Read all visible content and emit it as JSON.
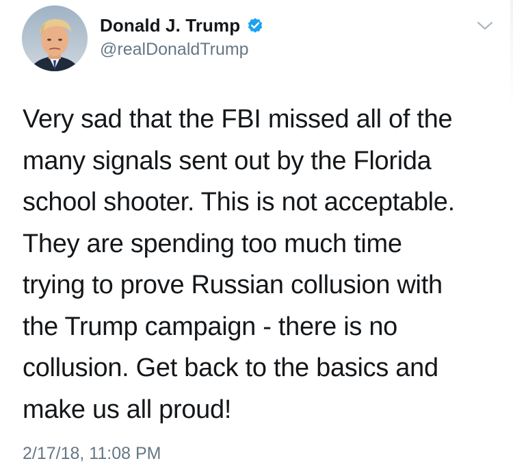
{
  "author": {
    "display_name": "Donald J. Trump",
    "handle": "@realDonaldTrump",
    "verified": true,
    "avatar_icon": "profile-photo"
  },
  "tweet": {
    "lines": [
      "Very sad that the FBI missed all of the",
      "many signals sent out by the Florida",
      "school shooter. This is not acceptable.",
      "They are spending too much time",
      "trying to prove Russian collusion with",
      "the Trump campaign - there is no",
      "collusion. Get back to the basics and",
      "make us all proud!"
    ],
    "timestamp": "2/17/18, 11:08 PM"
  },
  "icons": {
    "verified": "verified-badge-icon",
    "menu": "chevron-down-icon"
  },
  "colors": {
    "text_primary": "#14171a",
    "text_secondary": "#657786",
    "verified_blue": "#1da1f2",
    "chevron": "#aab8c2"
  }
}
